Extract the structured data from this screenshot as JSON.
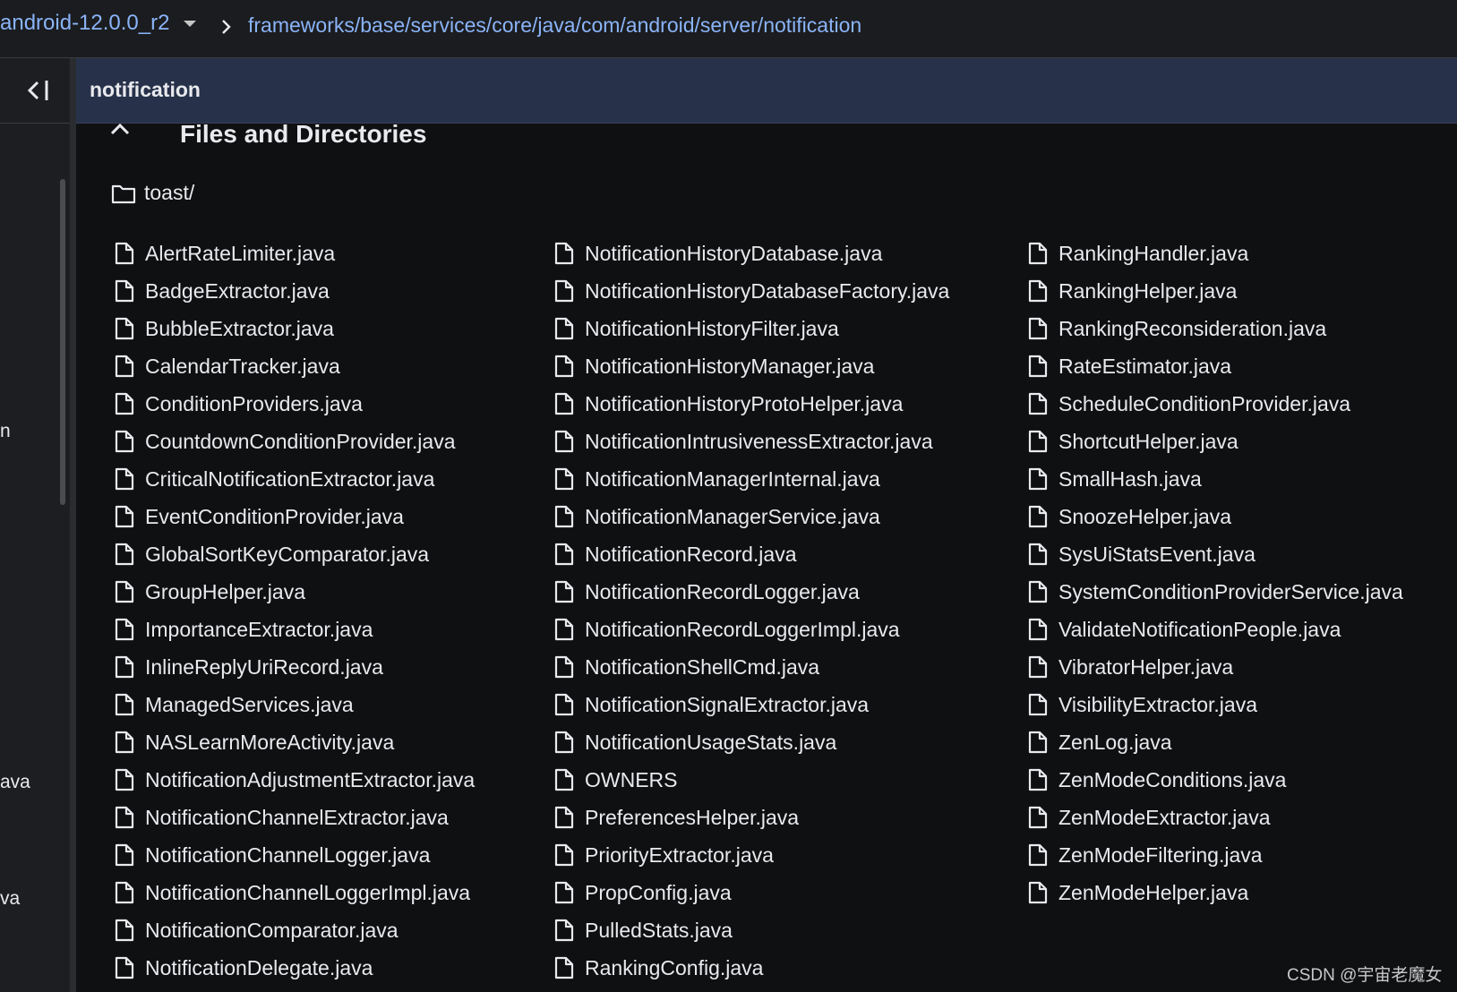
{
  "topbar": {
    "branch": "android-12.0.0_r2",
    "path": "frameworks/base/services/core/java/com/android/server/notification"
  },
  "sidebar": {
    "fragments": [
      "n",
      "ava",
      "va"
    ]
  },
  "header": {
    "title": "notification"
  },
  "section": {
    "title": "Files and Directories"
  },
  "directories": [
    "toast/"
  ],
  "columns": [
    [
      "AlertRateLimiter.java",
      "BadgeExtractor.java",
      "BubbleExtractor.java",
      "CalendarTracker.java",
      "ConditionProviders.java",
      "CountdownConditionProvider.java",
      "CriticalNotificationExtractor.java",
      "EventConditionProvider.java",
      "GlobalSortKeyComparator.java",
      "GroupHelper.java",
      "ImportanceExtractor.java",
      "InlineReplyUriRecord.java",
      "ManagedServices.java",
      "NASLearnMoreActivity.java",
      "NotificationAdjustmentExtractor.java",
      "NotificationChannelExtractor.java",
      "NotificationChannelLogger.java",
      "NotificationChannelLoggerImpl.java",
      "NotificationComparator.java",
      "NotificationDelegate.java"
    ],
    [
      "NotificationHistoryDatabase.java",
      "NotificationHistoryDatabaseFactory.java",
      "NotificationHistoryFilter.java",
      "NotificationHistoryManager.java",
      "NotificationHistoryProtoHelper.java",
      "NotificationIntrusivenessExtractor.java",
      "NotificationManagerInternal.java",
      "NotificationManagerService.java",
      "NotificationRecord.java",
      "NotificationRecordLogger.java",
      "NotificationRecordLoggerImpl.java",
      "NotificationShellCmd.java",
      "NotificationSignalExtractor.java",
      "NotificationUsageStats.java",
      "OWNERS",
      "PreferencesHelper.java",
      "PriorityExtractor.java",
      "PropConfig.java",
      "PulledStats.java",
      "RankingConfig.java"
    ],
    [
      "RankingHandler.java",
      "RankingHelper.java",
      "RankingReconsideration.java",
      "RateEstimator.java",
      "ScheduleConditionProvider.java",
      "ShortcutHelper.java",
      "SmallHash.java",
      "SnoozeHelper.java",
      "SysUiStatsEvent.java",
      "SystemConditionProviderService.java",
      "ValidateNotificationPeople.java",
      "VibratorHelper.java",
      "VisibilityExtractor.java",
      "ZenLog.java",
      "ZenModeConditions.java",
      "ZenModeExtractor.java",
      "ZenModeFiltering.java",
      "ZenModeHelper.java"
    ]
  ],
  "watermark": "CSDN @宇宙老魔女",
  "colors": {
    "background": "#0f1012",
    "topbar": "#1b1c1f",
    "header": "#27314a",
    "link": "#8ab4f8",
    "text": "#e8eaed"
  }
}
